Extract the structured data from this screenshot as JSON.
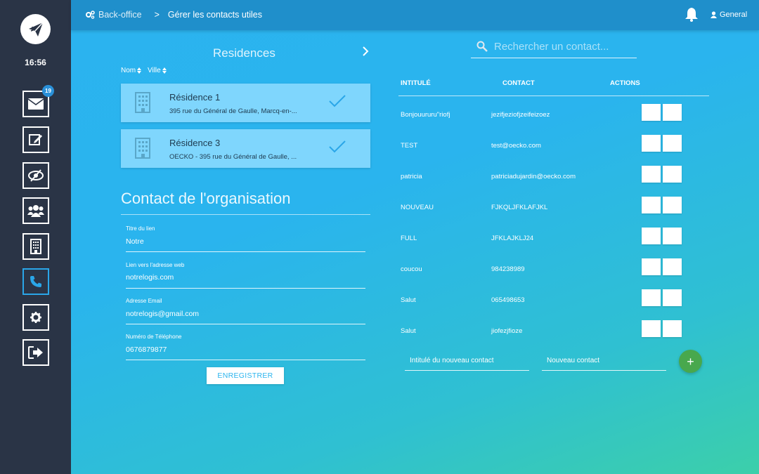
{
  "sidebar": {
    "clock": "16:56",
    "badge_count": "19",
    "items": [
      {
        "icon": "envelope-icon"
      },
      {
        "icon": "edit-icon"
      },
      {
        "icon": "eye-slash-icon"
      },
      {
        "icon": "users-icon"
      },
      {
        "icon": "building-icon"
      },
      {
        "icon": "phone-icon",
        "active": true
      },
      {
        "icon": "gear-icon"
      },
      {
        "icon": "sign-out-icon"
      }
    ]
  },
  "header": {
    "breadcrumb_root": "Back-office",
    "breadcrumb_separator": ">",
    "breadcrumb_current": "Gérer les contacts utiles",
    "user": "General"
  },
  "residences": {
    "title": "Residences",
    "sort_name": "Nom",
    "sort_city": "Ville",
    "items": [
      {
        "name": "Résidence 1",
        "address": "395 rue du Général de Gaulle, Marcq-en-..."
      },
      {
        "name": "Résidence 3",
        "address": "OECKO - 395 rue du Général de Gaulle, ..."
      }
    ]
  },
  "organisation": {
    "title": "Contact de l'organisation",
    "fields": [
      {
        "label": "Titre du lien",
        "value": "Notre"
      },
      {
        "label": "Lien vers l'adresse web",
        "value": "notrelogis.com"
      },
      {
        "label": "Adresse Email",
        "value": "notrelogis@gmail.com"
      },
      {
        "label": "Numéro de Téléphone",
        "value": "0676879877"
      }
    ],
    "save_label": "ENREGISTRER"
  },
  "contacts": {
    "search_placeholder": "Rechercher un contact...",
    "headers": {
      "title": "INTITULÉ",
      "contact": "CONTACT",
      "actions": "ACTIONS"
    },
    "rows": [
      {
        "title": "Bonjouururu\"riofj",
        "contact": "jezifjeziofjzeifeizoez"
      },
      {
        "title": "TEST",
        "contact": "test@oecko.com"
      },
      {
        "title": "patricia",
        "contact": "patriciadujardin@oecko.com"
      },
      {
        "title": "NOUVEAU",
        "contact": "FJKQLJFKLAFJKL"
      },
      {
        "title": "FULL",
        "contact": "JFKLAJKLJ24"
      },
      {
        "title": "coucou",
        "contact": "984238989"
      },
      {
        "title": "Salut",
        "contact": "065498653"
      },
      {
        "title": "Salut",
        "contact": "jiofezjfioze"
      }
    ],
    "new_title_placeholder": "Intitulé du nouveau contact",
    "new_contact_placeholder": "Nouveau contact",
    "add_label": "+"
  },
  "colors": {
    "sidebar": "#2a3446",
    "topbar": "#1f8fcb",
    "card": "#7fd6fd",
    "add_button": "#48a84d",
    "active_nav": "#2aa6e8"
  }
}
